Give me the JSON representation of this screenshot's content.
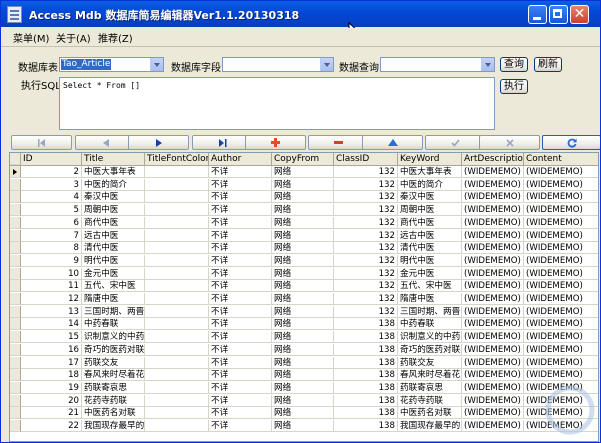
{
  "window": {
    "title": "Access Mdb 数据库简易编辑器Ver1.1.20130318"
  },
  "menu": [
    {
      "label": "菜单(M)"
    },
    {
      "label": "关于(A)"
    },
    {
      "label": "推荐(Z)"
    }
  ],
  "query": {
    "table_label": "数据库表",
    "table_value": "Tao_Article",
    "field_label": "数据库字段",
    "field_value": "",
    "search_label": "数据查询",
    "search_value": "",
    "query_button": "查询",
    "refresh_button": "刷新",
    "sql_label": "执行SQL",
    "sql_value": "Select * From []",
    "execute_button": "执行"
  },
  "navigator": [
    {
      "name": "first",
      "icon": "first-record-icon",
      "color": "#9aa6c0"
    },
    {
      "name": "prior",
      "icon": "prior-record-icon",
      "color": "#9aa6c0"
    },
    {
      "name": "next",
      "icon": "next-record-icon",
      "color": "#1f3f9f"
    },
    {
      "name": "last",
      "icon": "last-record-icon",
      "color": "#1f3f9f"
    },
    {
      "name": "insert",
      "icon": "plus-icon",
      "color": "#e0501c"
    },
    {
      "name": "delete",
      "icon": "minus-icon",
      "color": "#d93a2a"
    },
    {
      "name": "edit",
      "icon": "edit-up-icon",
      "color": "#2b6cd0"
    },
    {
      "name": "post",
      "icon": "check-icon",
      "color": "#9aa6c0"
    },
    {
      "name": "cancel",
      "icon": "cancel-icon",
      "color": "#9aa6c0"
    },
    {
      "name": "refresh",
      "icon": "refresh-icon",
      "color": "#2b6cd0"
    }
  ],
  "grid": {
    "columns": [
      "ID",
      "Title",
      "TitleFontColor",
      "Author",
      "CopyFrom",
      "ClassID",
      "KeyWord",
      "ArtDescription",
      "Content"
    ],
    "rows": [
      [
        "2",
        "中医大事年表",
        "",
        "不详",
        "网络",
        "132",
        "中医大事年表",
        "(WIDEMEMO)",
        "(WIDEMEMO)"
      ],
      [
        "3",
        "中医的简介",
        "",
        "不详",
        "网络",
        "132",
        "中医的简介",
        "(WIDEMEMO)",
        "(WIDEMEMO)"
      ],
      [
        "4",
        "秦汉中医",
        "",
        "不详",
        "网络",
        "132",
        "秦汉中医",
        "(WIDEMEMO)",
        "(WIDEMEMO)"
      ],
      [
        "5",
        "周朝中医",
        "",
        "不详",
        "网络",
        "132",
        "周朝中医",
        "(WIDEMEMO)",
        "(WIDEMEMO)"
      ],
      [
        "6",
        "商代中医",
        "",
        "不详",
        "网络",
        "132",
        "商代中医",
        "(WIDEMEMO)",
        "(WIDEMEMO)"
      ],
      [
        "7",
        "远古中医",
        "",
        "不详",
        "网络",
        "132",
        "远古中医",
        "(WIDEMEMO)",
        "(WIDEMEMO)"
      ],
      [
        "8",
        "清代中医",
        "",
        "不详",
        "网络",
        "132",
        "清代中医",
        "(WIDEMEMO)",
        "(WIDEMEMO)"
      ],
      [
        "9",
        "明代中医",
        "",
        "不详",
        "网络",
        "132",
        "明代中医",
        "(WIDEMEMO)",
        "(WIDEMEMO)"
      ],
      [
        "10",
        "金元中医",
        "",
        "不详",
        "网络",
        "132",
        "金元中医",
        "(WIDEMEMO)",
        "(WIDEMEMO)"
      ],
      [
        "11",
        "五代、宋中医",
        "",
        "不详",
        "网络",
        "132",
        "五代、宋中医",
        "(WIDEMEMO)",
        "(WIDEMEMO)"
      ],
      [
        "12",
        "隋唐中医",
        "",
        "不详",
        "网络",
        "132",
        "隋唐中医",
        "(WIDEMEMO)",
        "(WIDEMEMO)"
      ],
      [
        "13",
        "三国时期、两晋",
        "",
        "不详",
        "网络",
        "132",
        "三国时期、两晋",
        "(WIDEMEMO)",
        "(WIDEMEMO)"
      ],
      [
        "14",
        "中药春联",
        "",
        "不详",
        "网络",
        "138",
        "中药春联",
        "(WIDEMEMO)",
        "(WIDEMEMO)"
      ],
      [
        "15",
        "识制意义的中药",
        "",
        "不详",
        "网络",
        "138",
        "识制意义的中药",
        "(WIDEMEMO)",
        "(WIDEMEMO)"
      ],
      [
        "16",
        "奇巧的医药对联",
        "",
        "不详",
        "网络",
        "138",
        "奇巧的医药对联",
        "(WIDEMEMO)",
        "(WIDEMEMO)"
      ],
      [
        "17",
        "药联交友",
        "",
        "不详",
        "网络",
        "138",
        "药联交友",
        "(WIDEMEMO)",
        "(WIDEMEMO)"
      ],
      [
        "18",
        "春风来时尽着花",
        "",
        "不详",
        "网络",
        "138",
        "春风来时尽着花",
        "(WIDEMEMO)",
        "(WIDEMEMO)"
      ],
      [
        "19",
        "药联寄哀思",
        "",
        "不详",
        "网络",
        "138",
        "药联寄哀思",
        "(WIDEMEMO)",
        "(WIDEMEMO)"
      ],
      [
        "20",
        "花药寺药联",
        "",
        "不详",
        "网络",
        "138",
        "花药寺药联",
        "(WIDEMEMO)",
        "(WIDEMEMO)"
      ],
      [
        "21",
        "中医药名对联",
        "",
        "不详",
        "网络",
        "138",
        "中医药名对联",
        "(WIDEMEMO)",
        "(WIDEMEMO)"
      ],
      [
        "22",
        "我国现存最早的",
        "",
        "不详",
        "网络",
        "138",
        "我国现存最早的",
        "(WIDEMEMO)",
        "(WIDEMEMO)"
      ]
    ]
  }
}
